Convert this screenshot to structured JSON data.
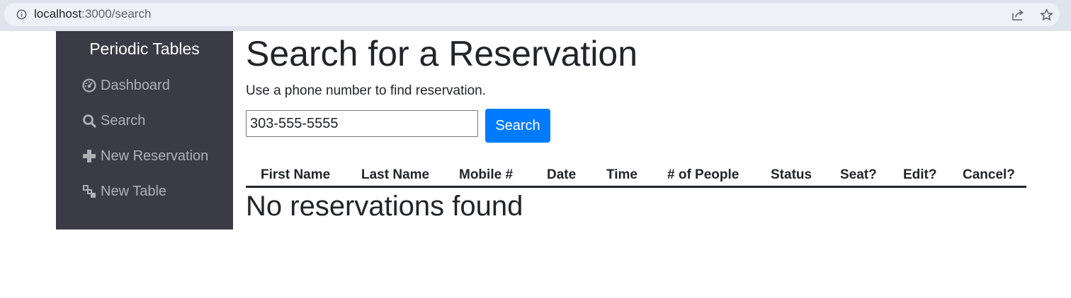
{
  "browser": {
    "url_host": "localhost",
    "url_path": ":3000/search",
    "icons": [
      "info-icon",
      "share-icon",
      "star-icon"
    ]
  },
  "sidebar": {
    "brand": "Periodic Tables",
    "items": [
      {
        "label": "Dashboard",
        "icon": "dashboard-icon"
      },
      {
        "label": "Search",
        "icon": "search-icon"
      },
      {
        "label": "New Reservation",
        "icon": "plus-icon"
      },
      {
        "label": "New Table",
        "icon": "table-icon"
      }
    ]
  },
  "main": {
    "title": "Search for a Reservation",
    "description": "Use a phone number to find reservation.",
    "search": {
      "value": "303-555-5555",
      "button_label": "Search"
    },
    "table": {
      "columns": [
        "First Name",
        "Last Name",
        "Mobile #",
        "Date",
        "Time",
        "# of People",
        "Status",
        "Seat?",
        "Edit?",
        "Cancel?"
      ]
    },
    "empty_message": "No reservations found"
  },
  "colors": {
    "sidebar_bg": "#3b3b46",
    "primary": "#007bff",
    "browser_bar": "#dee3ec"
  }
}
